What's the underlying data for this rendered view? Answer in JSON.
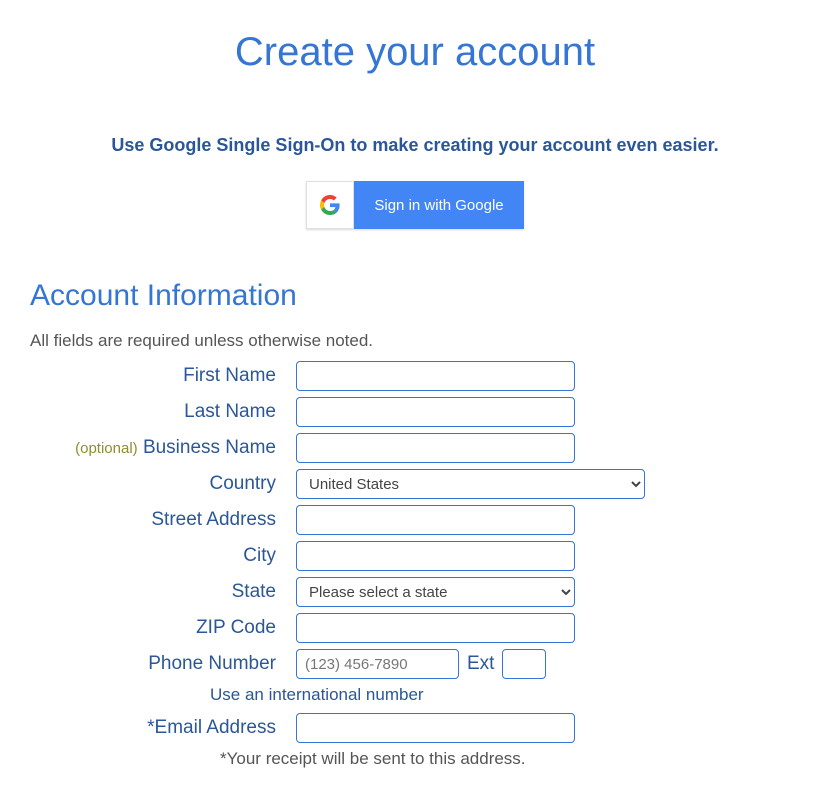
{
  "title": "Create your account",
  "sso_prompt": "Use Google Single Sign-On to make creating your account even easier.",
  "google_button": "Sign in with Google",
  "section_heading": "Account Information",
  "required_note": "All fields are required unless otherwise noted.",
  "optional_tag": "(optional)",
  "labels": {
    "first_name": "First Name",
    "last_name": "Last Name",
    "business_name": "Business Name",
    "country": "Country",
    "street": "Street Address",
    "city": "City",
    "state": "State",
    "zip": "ZIP Code",
    "phone": "Phone Number",
    "ext": "Ext",
    "email": "*Email Address"
  },
  "values": {
    "country_selected": "United States",
    "state_selected": "Please select a state"
  },
  "placeholders": {
    "phone": "(123) 456-7890"
  },
  "intl_link": "Use an international number",
  "receipt_note": "*Your receipt will be sent to this address."
}
